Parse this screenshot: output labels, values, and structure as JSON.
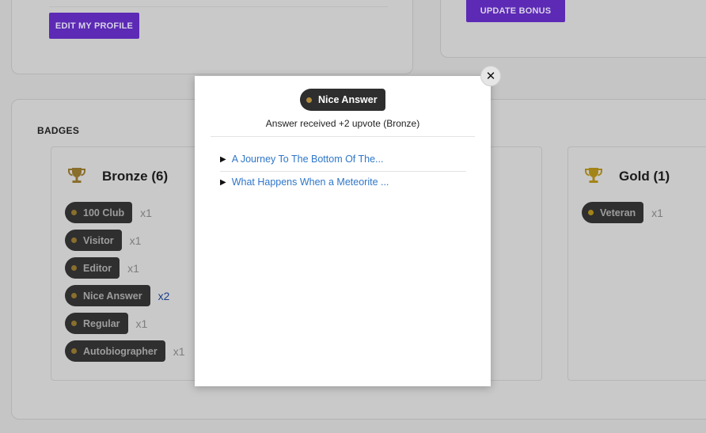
{
  "profile_card": {
    "edit_label": "EDIT MY PROFILE"
  },
  "bonus_card": {
    "update_label": "UPDATE BONUS"
  },
  "badges_section": {
    "title": "BADGES",
    "bronze": {
      "title": "Bronze (6)",
      "color": "#b08a3c",
      "items": [
        {
          "label": "100 Club",
          "count": "x1"
        },
        {
          "label": "Visitor",
          "count": "x1"
        },
        {
          "label": "Editor",
          "count": "x1"
        },
        {
          "label": "Nice Answer",
          "count": "x2"
        },
        {
          "label": "Regular",
          "count": "x1"
        },
        {
          "label": "Autobiographer",
          "count": "x1"
        }
      ]
    },
    "gold": {
      "title": "Gold (1)",
      "color": "#c9a21a",
      "items": [
        {
          "label": "Veteran",
          "count": "x1"
        }
      ]
    }
  },
  "modal": {
    "badge_label": "Nice Answer",
    "badge_color": "#b08a3c",
    "description": "Answer received +2 upvote (Bronze)",
    "close_icon": "close-icon",
    "links": [
      "A Journey To The Bottom Of The...",
      "What Happens When a Meteorite ..."
    ]
  },
  "colors": {
    "accent_purple": "#5c2ab5",
    "link_blue": "#2f76c9",
    "backdrop": "#c5c5c6"
  }
}
